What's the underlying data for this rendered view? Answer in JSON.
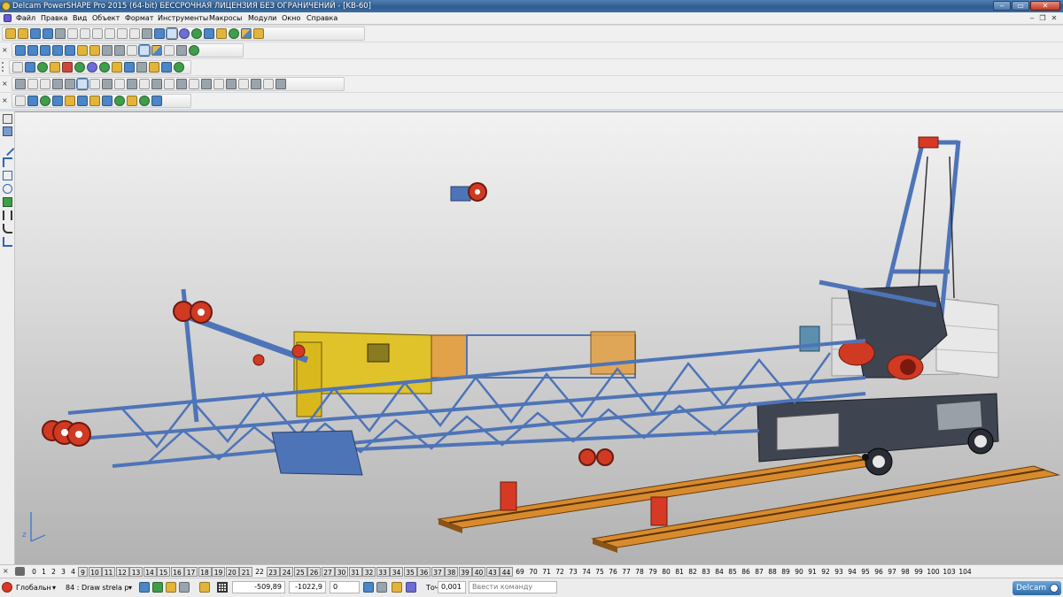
{
  "window": {
    "title": "Delcam PowerSHAPE Pro 2015 (64-bit) БЕССРОЧНАЯ ЛИЦЕНЗИЯ БЕЗ ОГРАНИЧЕНИЙ - [KB-60]",
    "minimize": "‒",
    "maximize": "▭",
    "close": "✕"
  },
  "menu": {
    "items": [
      "Файл",
      "Правка",
      "Вид",
      "Объект",
      "Формат",
      "Инструменты",
      "Макросы",
      "Модули",
      "Окно",
      "Справка"
    ],
    "mdi_minimize": "‒",
    "mdi_restore": "❐",
    "mdi_close": "✕"
  },
  "toolbars": {
    "close_glyph": "×"
  },
  "viewport": {
    "background": "#c8c8c8",
    "model_colors": {
      "frame": "#4e74b8",
      "motors": "#d03a22",
      "cabin": "#e0c22a",
      "rails": "#d88b2e",
      "counterweight": "#d8d8d8"
    },
    "axis_label": "z"
  },
  "level_bar": {
    "close_glyph": "×",
    "levels": [
      "0",
      "1",
      "2",
      "3",
      "4",
      "9",
      "10",
      "11",
      "12",
      "13",
      "14",
      "15",
      "16",
      "17",
      "18",
      "19",
      "20",
      "21",
      "22",
      "23",
      "24",
      "25",
      "26",
      "27",
      "30",
      "31",
      "32",
      "33",
      "34",
      "35",
      "36",
      "37",
      "38",
      "39",
      "40",
      "43",
      "44",
      "69",
      "70",
      "71",
      "72",
      "73",
      "74",
      "75",
      "76",
      "77",
      "78",
      "79",
      "80",
      "81",
      "82",
      "83",
      "84",
      "85",
      "86",
      "87",
      "88",
      "89",
      "90",
      "91",
      "92",
      "93",
      "94",
      "95",
      "96",
      "97",
      "98",
      "99",
      "100",
      "103",
      "104"
    ],
    "highlighted": [
      "9",
      "10",
      "11",
      "12",
      "13",
      "14",
      "15",
      "16",
      "17",
      "18",
      "19",
      "20",
      "21",
      "23",
      "24",
      "25",
      "26",
      "27",
      "30",
      "31",
      "32",
      "33",
      "34",
      "35",
      "36",
      "37",
      "38",
      "39",
      "40",
      "43",
      "44"
    ]
  },
  "status": {
    "coord_system": "Глобальн",
    "coord_dropdown": "▾",
    "level_active": "84 : Draw strela p",
    "level_dropdown": "▾",
    "x": "-509,89",
    "y": "-1022,9",
    "z": "0",
    "tolerance_label": "Точ",
    "tolerance_value": "0,001",
    "command_placeholder": "Ввести команду",
    "brand": "Delcam"
  }
}
